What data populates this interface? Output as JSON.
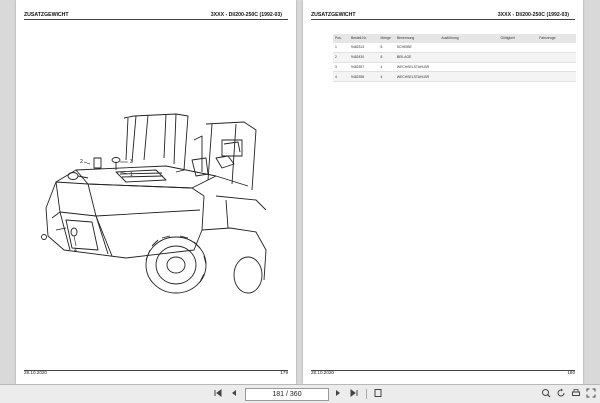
{
  "left_page": {
    "header_left": "ZUSATZGEWICHT",
    "header_right": "3XXX - DI/200-250C (1992-03)",
    "callouts": [
      "2",
      "3",
      "1",
      "4"
    ],
    "footer_date": "28.10.2020",
    "footer_page": "179"
  },
  "right_page": {
    "header_left": "ZUSATZGEWICHT",
    "header_right": "3XXX - DI/200-250C (1992-03)",
    "table": {
      "headers": [
        "Pos.",
        "Bestell-Nr.",
        "Menge",
        "Benennung",
        "Ausführung",
        "Gültigkeit",
        "Fahrzeuge"
      ],
      "rows": [
        [
          "1",
          "9482313",
          "8",
          "SCHEIBE",
          "",
          "",
          ""
        ],
        [
          "2",
          "9482430",
          "8",
          "BEILAGE",
          "",
          "",
          ""
        ],
        [
          "3",
          "9482397",
          "4",
          "WECHSELSTAHLBR",
          "",
          "",
          ""
        ],
        [
          "4",
          "9482398",
          "4",
          "WECHSELSTAHLBR",
          "",
          "",
          ""
        ]
      ]
    },
    "footer_date": "28.10.2020",
    "footer_page": "180"
  },
  "toolbar": {
    "page_display": "181 / 360",
    "icons": [
      "first-page-icon",
      "prev-page-icon",
      "next-page-icon",
      "last-page-icon",
      "fit-page-icon",
      "zoom-icon",
      "rotate-icon",
      "print-icon",
      "fullscreen-icon"
    ]
  }
}
